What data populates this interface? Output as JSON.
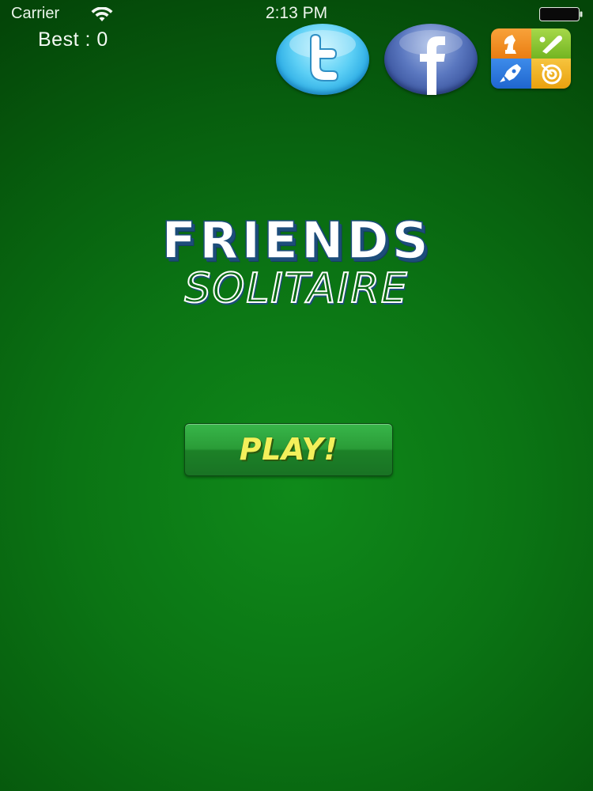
{
  "status_bar": {
    "carrier": "Carrier",
    "time": "2:13 PM",
    "icons": [
      "wifi-icon",
      "battery-icon"
    ]
  },
  "score": {
    "best_label": "Best : 0",
    "best_value": 0
  },
  "social": {
    "twitter_icon": "twitter-icon",
    "facebook_icon": "facebook-icon",
    "game_center_icon": "game-center-icon"
  },
  "title": {
    "line1": "FRIENDS",
    "line2": "SOLITAIRE"
  },
  "play_button": {
    "label": "PLAY!"
  },
  "colors": {
    "background": "#0b7414",
    "play_text": "#f3f05b",
    "title_outline": "#1d4d7a"
  }
}
